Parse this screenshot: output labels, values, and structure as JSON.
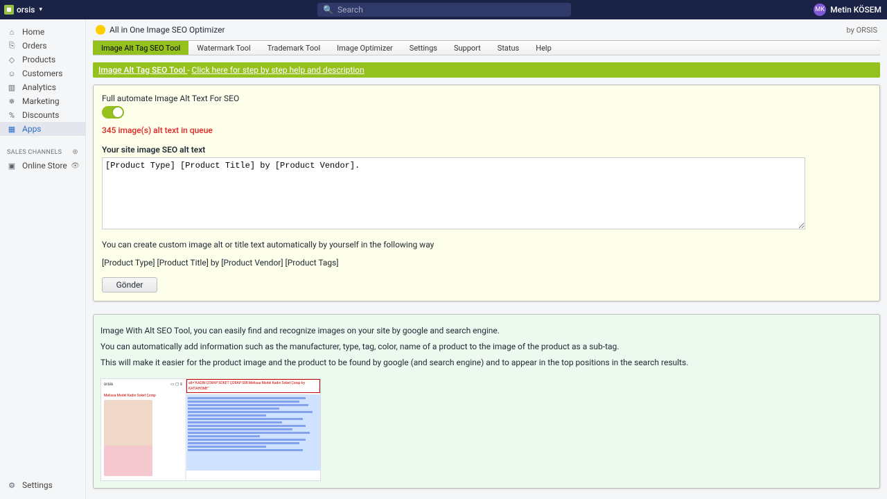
{
  "topbar": {
    "shop_name": "orsis",
    "search_placeholder": "Search",
    "user_initials": "MK",
    "user_name": "Metin KÖSEM"
  },
  "sidebar": {
    "items": [
      {
        "label": "Home",
        "icon": "⌂"
      },
      {
        "label": "Orders",
        "icon": "⎘"
      },
      {
        "label": "Products",
        "icon": "◇"
      },
      {
        "label": "Customers",
        "icon": "☺"
      },
      {
        "label": "Analytics",
        "icon": "▥"
      },
      {
        "label": "Marketing",
        "icon": "✵"
      },
      {
        "label": "Discounts",
        "icon": "%"
      },
      {
        "label": "Apps",
        "icon": "▦"
      }
    ],
    "section_label": "SALES CHANNELS",
    "channels": [
      {
        "label": "Online Store",
        "icon": "▣"
      }
    ],
    "settings_label": "Settings"
  },
  "header": {
    "app_title": "All in One Image SEO Optimizer",
    "byline": "by ORSIS"
  },
  "tabs": [
    "Image Alt Tag SEO Tool",
    "Watermark Tool",
    "Trademark Tool",
    "Image Optimizer",
    "Settings",
    "Support",
    "Status",
    "Help"
  ],
  "banner": {
    "title": "Image Alt Tag SEO Tool ",
    "sep": " - ",
    "link": "Click here for step by step help and description"
  },
  "panel": {
    "toggle_label": "Full automate Image Alt Text For SEO",
    "queue_text": "345 image(s) alt text in queue",
    "textarea_label": "Your site image SEO alt text",
    "textarea_value": "[Product Type] [Product Title] by [Product Vendor].",
    "hint_line": "You can create custom image alt or title text automatically by yourself in the following way",
    "template_line": "[Product Type] [Product Title] by [Product Vendor] [Product Tags]",
    "submit_label": "Gönder"
  },
  "info": {
    "p1": "Image With Alt SEO Tool, you can easily find and recognize images on your site by google and search engine.",
    "p2": "You can automatically add information such as the manufacturer, type, tag, color, name of a product to the image of the product as a sub-tag.",
    "p3": "This will make it easier for the product image and the product to be found by google (and search engine) and to appear in the top positions in the search results."
  }
}
